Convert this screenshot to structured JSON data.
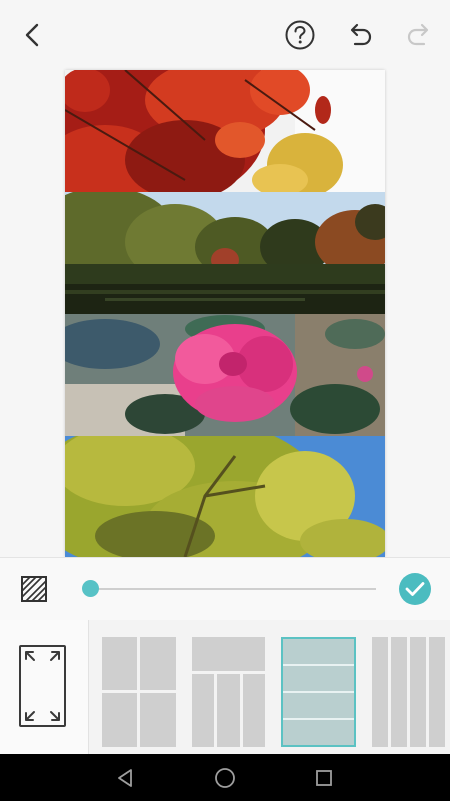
{
  "app": {
    "screen": "collage-layout-editor"
  },
  "toolbar": {
    "back_icon": "chevron-left-icon",
    "help_icon": "question-circle-icon",
    "undo_icon": "undo-icon",
    "redo_icon": "redo-icon",
    "redo_enabled": false
  },
  "collage": {
    "photos": [
      {
        "subject": "red-maple-leaves",
        "colors": [
          "#b8211a",
          "#e04a23",
          "#d9b13a",
          "#ffffff"
        ]
      },
      {
        "subject": "japanese-garden-pond",
        "colors": [
          "#5d6b2a",
          "#8a5a25",
          "#bad4ea",
          "#1e2516"
        ]
      },
      {
        "subject": "pink-camellia-flower",
        "colors": [
          "#e83f8a",
          "#2e4a3a",
          "#c9c4b8",
          "#5a7a8c"
        ]
      },
      {
        "subject": "yellow-green-tree-canopy",
        "colors": [
          "#9aa830",
          "#c8c64a",
          "#4c8bd6",
          "#5a6222"
        ]
      }
    ]
  },
  "adjust": {
    "pattern_icon": "diagonal-stripes-icon",
    "slider_value": 0,
    "confirm_icon": "check-icon",
    "accent": "#4bbcc0"
  },
  "layouts": {
    "aspect_icon": "expand-arrows-icon",
    "options": [
      {
        "id": "grid-2x2",
        "selected": false
      },
      {
        "id": "top-1-bottom-3",
        "selected": false
      },
      {
        "id": "rows-4",
        "selected": true
      },
      {
        "id": "columns-4",
        "selected": false
      }
    ]
  },
  "system_nav": {
    "back_icon": "triangle-back-icon",
    "home_icon": "circle-home-icon",
    "recents_icon": "square-recents-icon"
  }
}
